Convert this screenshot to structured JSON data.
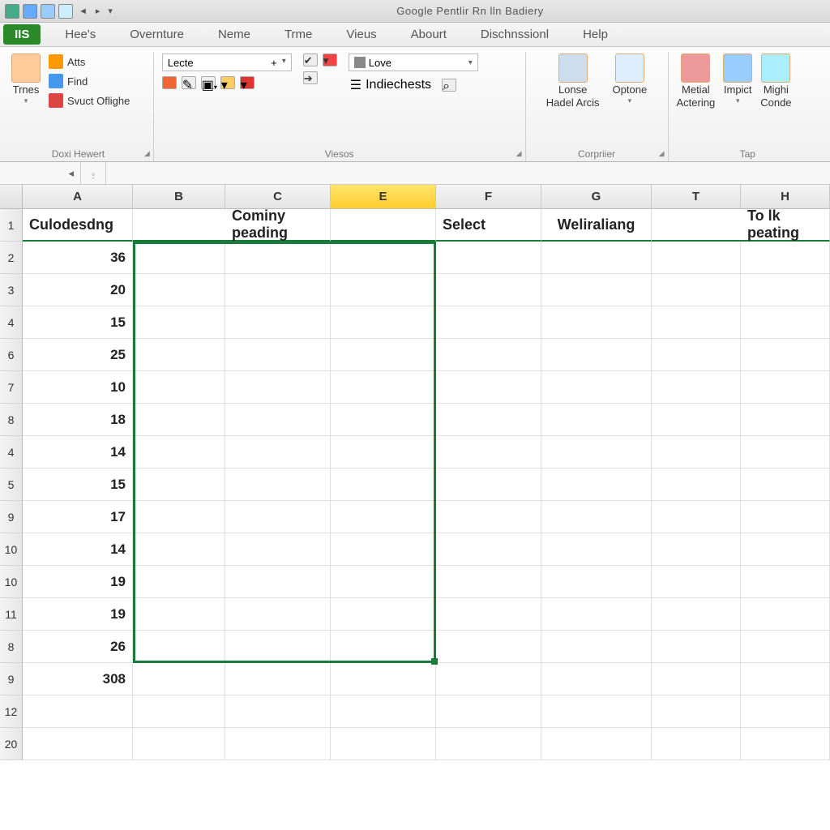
{
  "window": {
    "title": "Google Pentlir Rn lln Badiery"
  },
  "menubar": {
    "active": "IIS",
    "items": [
      "IIS",
      "Hee's",
      "Overnture",
      "Neme",
      "Trme",
      "Vieus",
      "Abourt",
      "Dischnssionl",
      "Help"
    ]
  },
  "ribbon": {
    "group1": {
      "label": "Doxi Hewert",
      "big": "Trnes",
      "items": [
        "Atts",
        "Find",
        "Svuct Oflighe"
      ]
    },
    "group2": {
      "label": "Viesos",
      "combo1": "Lecte",
      "combo2": "Love",
      "indiechests": "Indiechests"
    },
    "group3": {
      "label": "Corpriier",
      "items": [
        {
          "line1": "Lonse",
          "line2": "Hadel Arcis"
        },
        {
          "line1": "Optone",
          "line2": ""
        }
      ]
    },
    "group4": {
      "label": "Tap",
      "items": [
        {
          "line1": "Metial",
          "line2": "Actering"
        },
        {
          "line1": "Impict",
          "line2": ""
        },
        {
          "line1": "Mighi",
          "line2": "Conde"
        }
      ]
    }
  },
  "columns": [
    "A",
    "B",
    "C",
    "E",
    "F",
    "G",
    "T",
    "H"
  ],
  "selected_col": "E",
  "headers": {
    "A": "Culodesdng",
    "BC": "Cominy peading",
    "F": "Select",
    "G": "Weliraliang",
    "TH": "To lk peating"
  },
  "row_labels": [
    "1",
    "2",
    "3",
    "4",
    "6",
    "7",
    "8",
    "4",
    "5",
    "9",
    "10",
    "10",
    "11",
    "8",
    "9",
    "12",
    "20"
  ],
  "colA_values": [
    "36",
    "20",
    "15",
    "25",
    "10",
    "18",
    "14",
    "15",
    "17",
    "14",
    "19",
    "19",
    "26",
    "308",
    "",
    ""
  ],
  "chart_data": {
    "type": "table",
    "title": "Spreadsheet column A numeric values",
    "categories": [
      "2",
      "3",
      "4",
      "6",
      "7",
      "8",
      "4",
      "5",
      "9",
      "10",
      "10",
      "11",
      "8",
      "9"
    ],
    "values": [
      36,
      20,
      15,
      25,
      10,
      18,
      14,
      15,
      17,
      14,
      19,
      19,
      26,
      308
    ]
  }
}
